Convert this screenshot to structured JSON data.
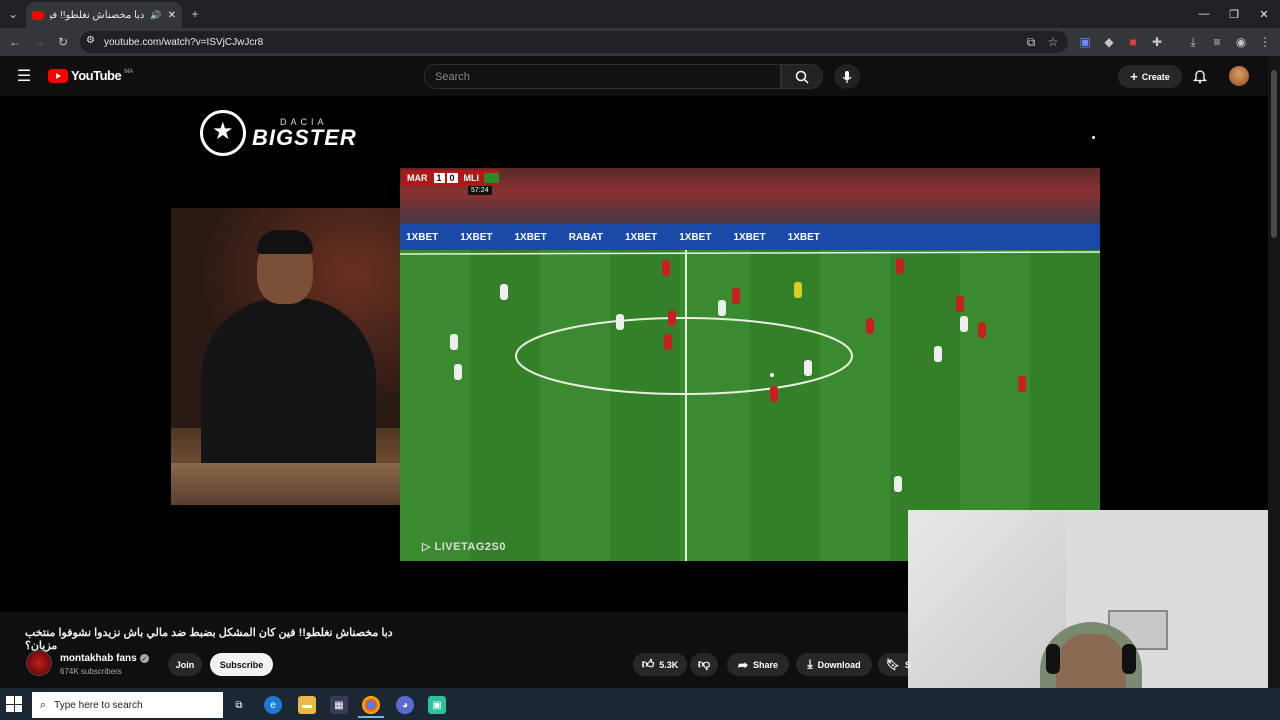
{
  "browser": {
    "tab_title": "دبا مخصناش نغلطو!! فين كا...",
    "url": "youtube.com/watch?v=ISVjCJwJcr8",
    "tab_close": "✕",
    "new_tab": "+",
    "minimize": "—",
    "restore": "❐",
    "close": "✕"
  },
  "youtube": {
    "logo_text": "YouTube",
    "country_code": "MA",
    "search_placeholder": "Search",
    "create_label": "Create"
  },
  "video": {
    "sponsor_top": "DACIA",
    "sponsor_main": "BIGSTER",
    "scoreboard": {
      "home": "MAR",
      "home_score": "1",
      "away_score": "0",
      "away": "MLI",
      "clock": "57:24"
    },
    "boards": [
      "1XBET",
      "1XBET",
      "1XBET",
      "RABAT",
      "1XBET",
      "1XBET",
      "1XBET",
      "1XBET"
    ],
    "watermark": "LIVETAG2S0"
  },
  "meta": {
    "title": "دبا مخصناش نغلطو!! فين كان المشكل بضبط ضد مالي باش نزيدوا نشوفوا منتخب مزيان؟",
    "channel_name": "montakhab fans",
    "subscribers": "674K subscribers",
    "join_label": "Join",
    "subscribe_label": "Subscribe",
    "likes": "5.3K",
    "share_label": "Share",
    "download_label": "Download",
    "save_label": "S"
  },
  "taskbar": {
    "search_placeholder": "Type here to search"
  },
  "colors": {
    "youtube_red": "#ff0000",
    "background": "#0f0f0f",
    "taskbar": "#1c2734"
  }
}
